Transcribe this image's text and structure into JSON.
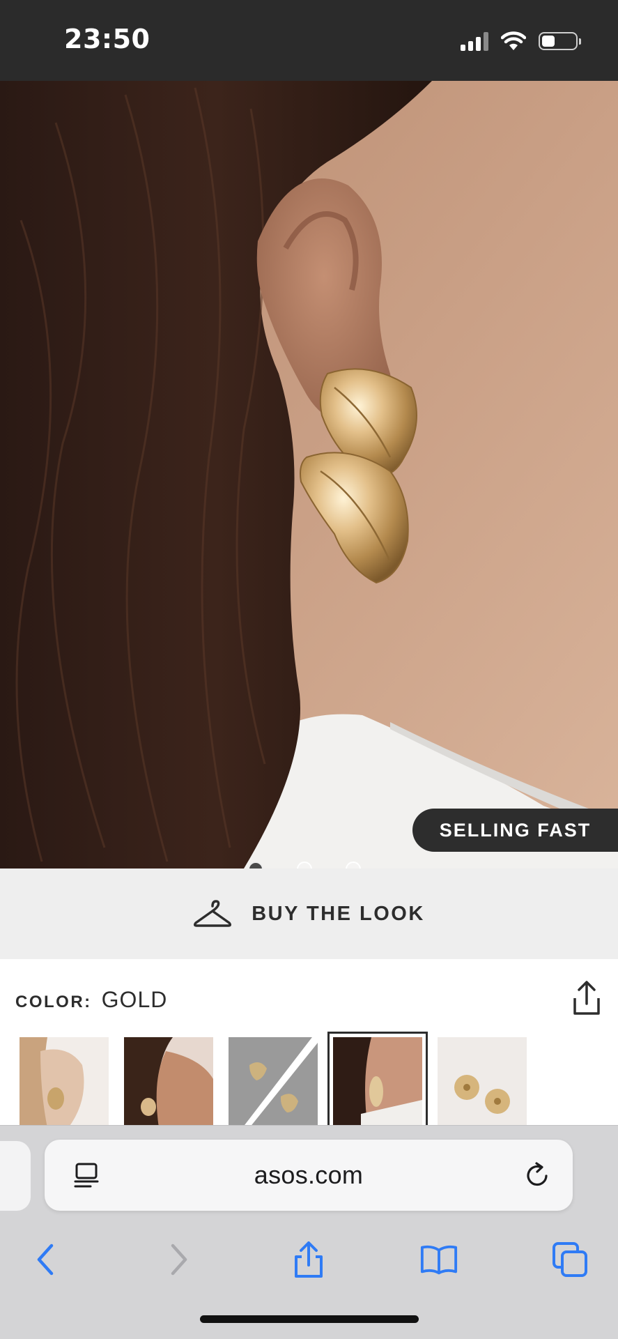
{
  "status_bar": {
    "time": "23:50"
  },
  "product": {
    "badge": "SELLING FAST",
    "carousel": {
      "count": 3,
      "active_index": 0
    },
    "buy_the_look": "BUY THE LOOK",
    "color_label": "COLOR:",
    "color_value": "GOLD",
    "thumbnails": [
      {
        "name": "thumb-model-front",
        "selected": false
      },
      {
        "name": "thumb-model-side",
        "selected": false
      },
      {
        "name": "thumb-product-flat",
        "selected": false
      },
      {
        "name": "thumb-model-closeup",
        "selected": true
      },
      {
        "name": "thumb-product-pair",
        "selected": false
      }
    ]
  },
  "browser": {
    "url": "asos.com",
    "icons": {
      "reader": "reader-view-icon",
      "reload": "reload-icon",
      "back": "back-icon",
      "forward": "forward-icon",
      "share": "share-icon",
      "bookmarks": "bookmarks-icon",
      "tabs": "tabs-icon"
    },
    "accent_color": "#2f7bf5",
    "disabled_color": "#a9a9ad"
  },
  "colors": {
    "status_bar": "#2b2b2b",
    "badge_bg": "#2d2d2d",
    "buy_look_bg": "#eeeeee",
    "text": "#2d2d2d"
  }
}
